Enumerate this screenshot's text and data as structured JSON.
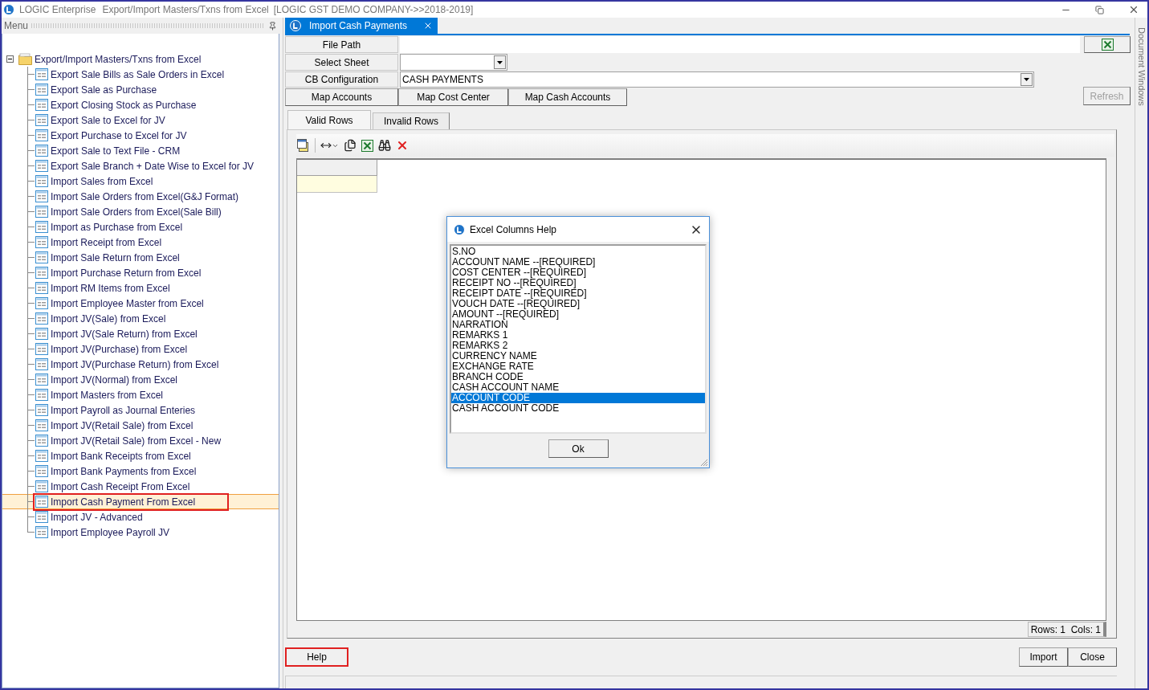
{
  "window": {
    "title": "LOGIC Enterprise",
    "subtitle": "Export/Import Masters/Txns from Excel",
    "company": "[LOGIC GST DEMO COMPANY->>2018-2019]"
  },
  "menu_panel": {
    "title": "Menu",
    "tree": {
      "label": "Export/Import Masters/Txns from Excel",
      "expanded": true,
      "children": [
        {
          "label": "Export Sale Bills as Sale Orders in Excel",
          "selected": false
        },
        {
          "label": "Export Sale as Purchase",
          "selected": false
        },
        {
          "label": "Export Closing Stock as Purchase",
          "selected": false
        },
        {
          "label": "Export Sale to Excel for JV",
          "selected": false
        },
        {
          "label": "Export Purchase to Excel for JV",
          "selected": false
        },
        {
          "label": "Export Sale to Text File - CRM",
          "selected": false
        },
        {
          "label": "Export Sale Branch + Date Wise to Excel for JV",
          "selected": false
        },
        {
          "label": "Import Sales from Excel",
          "selected": false
        },
        {
          "label": "Import Sale Orders from Excel(G&J Format)",
          "selected": false
        },
        {
          "label": "Import Sale Orders from Excel(Sale Bill)",
          "selected": false
        },
        {
          "label": "Import as Purchase from Excel",
          "selected": false
        },
        {
          "label": "Import Receipt from Excel",
          "selected": false
        },
        {
          "label": "Import Sale Return from Excel",
          "selected": false
        },
        {
          "label": "Import Purchase Return from Excel",
          "selected": false
        },
        {
          "label": "Import RM Items from Excel",
          "selected": false
        },
        {
          "label": "Import Employee Master from Excel",
          "selected": false
        },
        {
          "label": "Import JV(Sale) from Excel",
          "selected": false
        },
        {
          "label": "Import JV(Sale Return) from Excel",
          "selected": false
        },
        {
          "label": "Import JV(Purchase) from Excel",
          "selected": false
        },
        {
          "label": "Import JV(Purchase Return) from Excel",
          "selected": false
        },
        {
          "label": "Import JV(Normal) from Excel",
          "selected": false
        },
        {
          "label": "Import Masters from Excel",
          "selected": false
        },
        {
          "label": "Import Payroll as Journal Enteries",
          "selected": false
        },
        {
          "label": "Import JV(Retail Sale) from Excel",
          "selected": false
        },
        {
          "label": "Import JV(Retail Sale) from Excel - New",
          "selected": false
        },
        {
          "label": "Import Bank Receipts from Excel",
          "selected": false
        },
        {
          "label": "Import Bank Payments from Excel",
          "selected": false
        },
        {
          "label": "Import Cash Receipt From Excel",
          "selected": false
        },
        {
          "label": "Import Cash Payment From Excel",
          "selected": true
        },
        {
          "label": "Import JV - Advanced",
          "selected": false
        },
        {
          "label": "Import Employee Payroll JV",
          "selected": false
        }
      ]
    }
  },
  "document_tab": {
    "title": "Import Cash Payments"
  },
  "form": {
    "file_path": {
      "label": "File Path"
    },
    "select_sheet": {
      "label": "Select Sheet"
    },
    "cb_configuration": {
      "label": "CB Configuration",
      "value": "CASH PAYMENTS"
    },
    "map_buttons": [
      "Map Accounts",
      "Map Cost Center",
      "Map Cash Accounts"
    ],
    "refresh": {
      "label": "Refresh",
      "disabled": true
    }
  },
  "grid_tabs": [
    {
      "label": "Valid Rows",
      "selected": true
    },
    {
      "label": "Invalid Rows",
      "selected": false
    }
  ],
  "grid_status": "Rows: 1  Cols: 1",
  "footer_buttons": [
    {
      "label": "Help",
      "highlighted": true
    },
    {
      "label": "Import",
      "highlighted": false
    },
    {
      "label": "Close",
      "highlighted": false
    }
  ],
  "side_strip": {
    "label": "Document Windows"
  },
  "dialog": {
    "title": "Excel Columns Help",
    "items": [
      {
        "label": "S.NO",
        "selected": false
      },
      {
        "label": "ACCOUNT NAME --[REQUIRED]",
        "selected": false
      },
      {
        "label": "COST CENTER --[REQUIRED]",
        "selected": false
      },
      {
        "label": "RECEIPT NO --[REQUIRED]",
        "selected": false
      },
      {
        "label": "RECEIPT DATE --[REQUIRED]",
        "selected": false
      },
      {
        "label": "VOUCH DATE --[REQUIRED]",
        "selected": false
      },
      {
        "label": "AMOUNT --[REQUIRED]",
        "selected": false
      },
      {
        "label": "NARRATION",
        "selected": false
      },
      {
        "label": "REMARKS 1",
        "selected": false
      },
      {
        "label": "REMARKS 2",
        "selected": false
      },
      {
        "label": "CURRENCY NAME",
        "selected": false
      },
      {
        "label": "EXCHANGE RATE",
        "selected": false
      },
      {
        "label": "BRANCH CODE",
        "selected": false
      },
      {
        "label": "CASH ACCOUNT NAME",
        "selected": false
      },
      {
        "label": "ACCOUNT CODE",
        "selected": true
      },
      {
        "label": "CASH ACCOUNT CODE",
        "selected": false
      }
    ],
    "ok": "Ok"
  }
}
